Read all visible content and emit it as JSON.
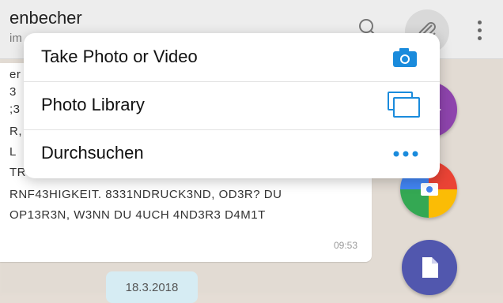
{
  "header": {
    "title": "enbecher",
    "subtitle": "im"
  },
  "chat": {
    "message_lines": [
      "er",
      "3",
      ";3",
      "R,",
      "L",
      "TR",
      "RNF43HIGKEIT. 8331NDRUCK3ND, OD3R? DU",
      "OP13R3N, W3NN DU 4UCH 4ND3R3 D4M1T"
    ],
    "time": "09:53",
    "date_chip": "18.3.2018"
  },
  "menu": {
    "items": [
      {
        "label": "Take Photo or Video",
        "icon": "camera-icon"
      },
      {
        "label": "Photo Library",
        "icon": "photo-library-icon"
      },
      {
        "label": "Durchsuchen",
        "icon": "more-dots-icon"
      }
    ]
  },
  "colors": {
    "ios_blue": "#1a8bdc",
    "fab_purple": "#8e44ad",
    "fab_doc": "#5157ae"
  }
}
